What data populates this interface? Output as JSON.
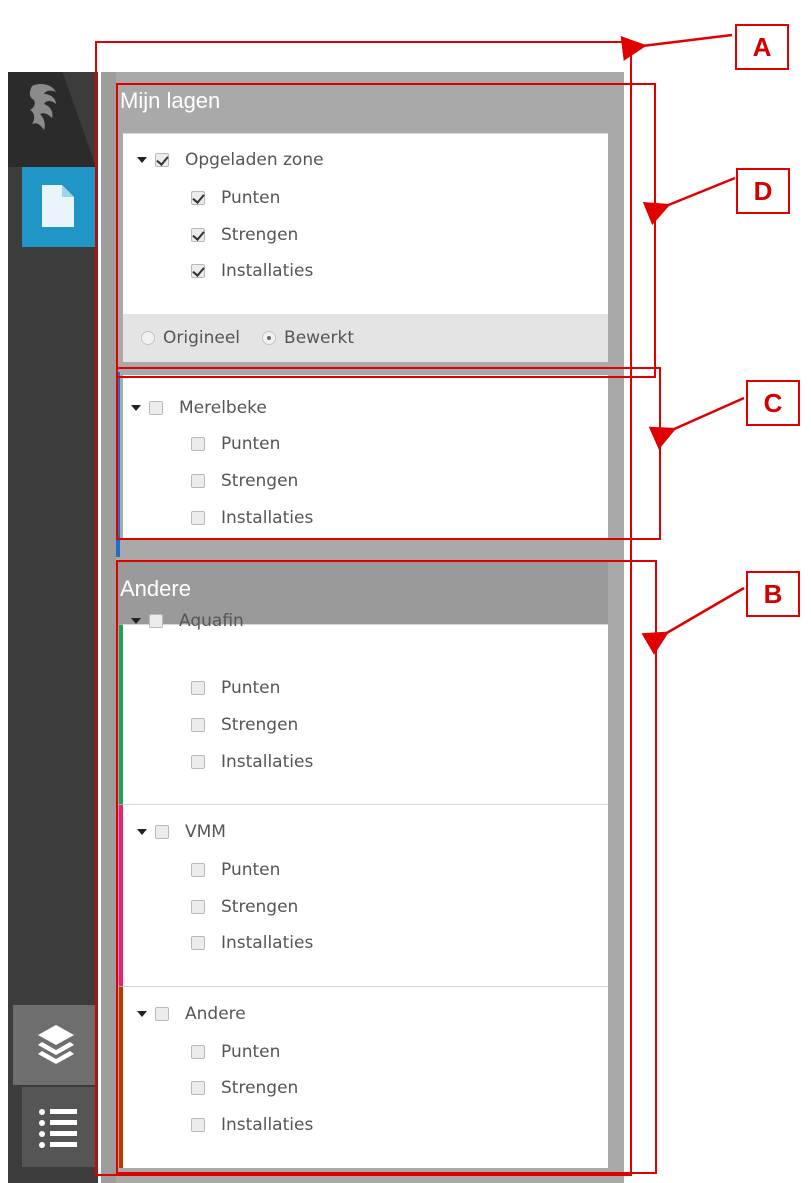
{
  "sidebar": {
    "items": [
      {
        "icon": "lion-logo-icon"
      },
      {
        "icon": "document-icon",
        "active": true
      },
      {
        "icon": "layers-icon"
      },
      {
        "icon": "list-icon"
      }
    ]
  },
  "my_layers": {
    "title": "Mijn lagen",
    "groups": [
      {
        "label": "Opgeladen zone",
        "checked": true,
        "items": [
          {
            "label": "Punten",
            "checked": true
          },
          {
            "label": "Strengen",
            "checked": true
          },
          {
            "label": "Installaties",
            "checked": true
          }
        ],
        "version": {
          "original_label": "Origineel",
          "edited_label": "Bewerkt",
          "selected": "Bewerkt"
        }
      },
      {
        "label": "Merelbeke",
        "checked": false,
        "items": [
          {
            "label": "Punten",
            "checked": false
          },
          {
            "label": "Strengen",
            "checked": false
          },
          {
            "label": "Installaties",
            "checked": false
          }
        ]
      }
    ]
  },
  "other_layers": {
    "title": "Andere",
    "groups": [
      {
        "label": "Aquafin",
        "checked": false,
        "accent_color": "#1aa35a",
        "items": [
          {
            "label": "Punten",
            "checked": false
          },
          {
            "label": "Strengen",
            "checked": false
          },
          {
            "label": "Installaties",
            "checked": false
          }
        ]
      },
      {
        "label": "VMM",
        "checked": false,
        "accent_color": "#e8207a",
        "items": [
          {
            "label": "Punten",
            "checked": false
          },
          {
            "label": "Strengen",
            "checked": false
          },
          {
            "label": "Installaties",
            "checked": false
          }
        ]
      },
      {
        "label": "Andere",
        "checked": false,
        "accent_color": "#b83a00",
        "items": [
          {
            "label": "Punten",
            "checked": false
          },
          {
            "label": "Strengen",
            "checked": false
          },
          {
            "label": "Installaties",
            "checked": false
          }
        ]
      }
    ]
  },
  "annotations": {
    "labels": [
      "A",
      "D",
      "C",
      "B"
    ],
    "color": "#e00000"
  },
  "colors": {
    "rail": "#3c3c3c",
    "active_button": "#1f96c6",
    "panel": "#a9a9a9",
    "my_layers_accent": "#1f6fc6"
  }
}
